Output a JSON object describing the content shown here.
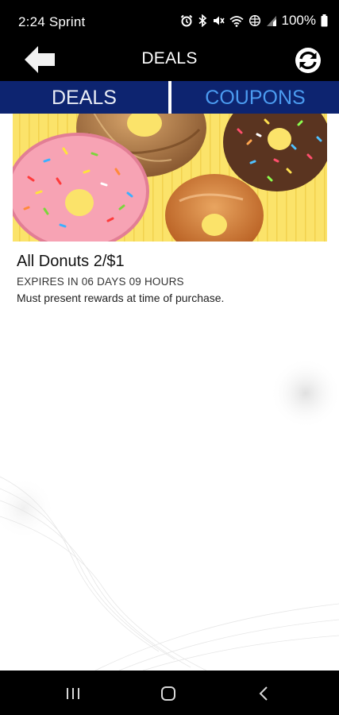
{
  "status_bar": {
    "time": "2:24",
    "carrier": "Sprint",
    "battery": "100%",
    "icons": [
      "alarm-icon",
      "bluetooth-icon",
      "mute-icon",
      "wifi-icon",
      "hotspot-icon",
      "signal-icon",
      "battery-icon"
    ]
  },
  "header": {
    "title": "DEALS",
    "back_icon": "arrow-left-icon",
    "refresh_icon": "refresh-icon"
  },
  "tabs": [
    {
      "label": "DEALS",
      "active": true
    },
    {
      "label": "COUPONS",
      "active": false
    }
  ],
  "deals": [
    {
      "title": "All Donuts 2/$1",
      "expires": "EXPIRES IN 06 DAYS 09 HOURS",
      "note": "Must present rewards at time of purchase."
    }
  ],
  "colors": {
    "tab_bar": "#0d2470",
    "tab_active_text": "#e8ecf5",
    "tab_inactive_text": "#4b9bf0",
    "image_background": "#fbe36a"
  },
  "nav_bar": {
    "icons": [
      "recent-apps-icon",
      "home-icon",
      "back-nav-icon"
    ]
  }
}
